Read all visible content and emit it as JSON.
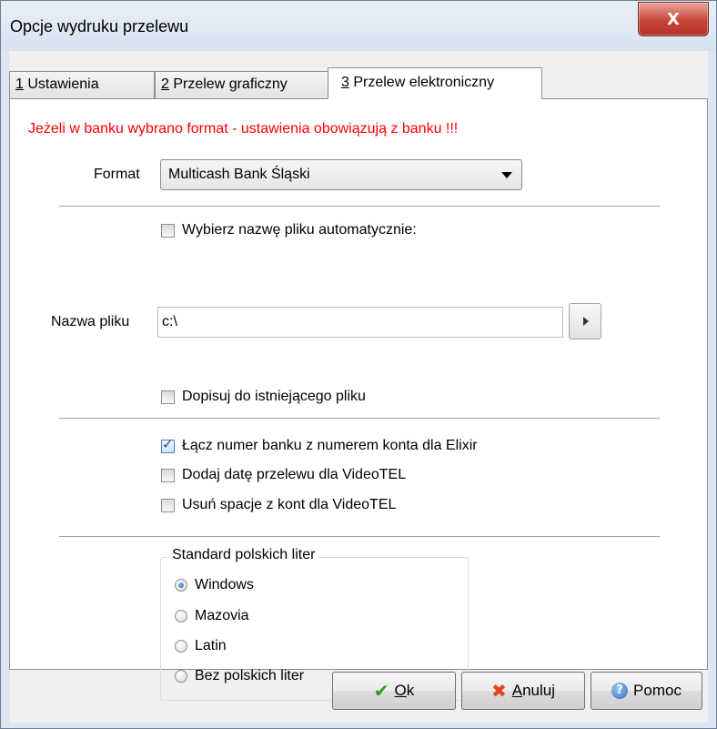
{
  "window": {
    "title": "Opcje wydruku przelewu",
    "close_glyph": "X"
  },
  "tabs": [
    {
      "num": "1",
      "label": " Ustawienia",
      "active": false
    },
    {
      "num": "2",
      "label": " Przelew graficzny",
      "active": false
    },
    {
      "num": "3",
      "label": " Przelew elektroniczny",
      "active": true
    }
  ],
  "panel": {
    "warning": "Jeżeli w banku wybrano format - ustawienia obowiązują z banku !!!",
    "format_label": "Format",
    "format_value": "Multicash Bank Śląski",
    "auto_filename_label": "Wybierz nazwę pliku automatycznie:",
    "auto_filename_checked": false,
    "filename_label": "Nazwa pliku",
    "filename_value": "c:\\",
    "append_label": "Dopisuj do istniejącego pliku",
    "append_checked": false,
    "join_bank_label": "Łącz numer banku z numerem konta dla Elixir",
    "join_bank_checked": true,
    "add_date_label": "Dodaj datę przelewu dla VideoTEL",
    "add_date_checked": false,
    "remove_spaces_label": "Usuń spacje z kont dla VideoTEL",
    "remove_spaces_checked": false
  },
  "charset_group": {
    "title": "Standard polskich liter",
    "options": [
      {
        "label": "Windows",
        "selected": true
      },
      {
        "label": "Mazovia",
        "selected": false
      },
      {
        "label": "Latin",
        "selected": false
      },
      {
        "label": "Bez polskich liter",
        "selected": false
      }
    ]
  },
  "buttons": {
    "ok_mnemonic": "O",
    "ok_rest": "k",
    "cancel_mnemonic": "A",
    "cancel_rest": "nuluj",
    "help": "Pomoc"
  },
  "icons": {
    "close": "close-icon",
    "combo": "chevron-down-icon",
    "browse": "chevron-right-icon",
    "ok": "checkmark-icon",
    "cancel": "x-icon",
    "help": "help-icon"
  }
}
